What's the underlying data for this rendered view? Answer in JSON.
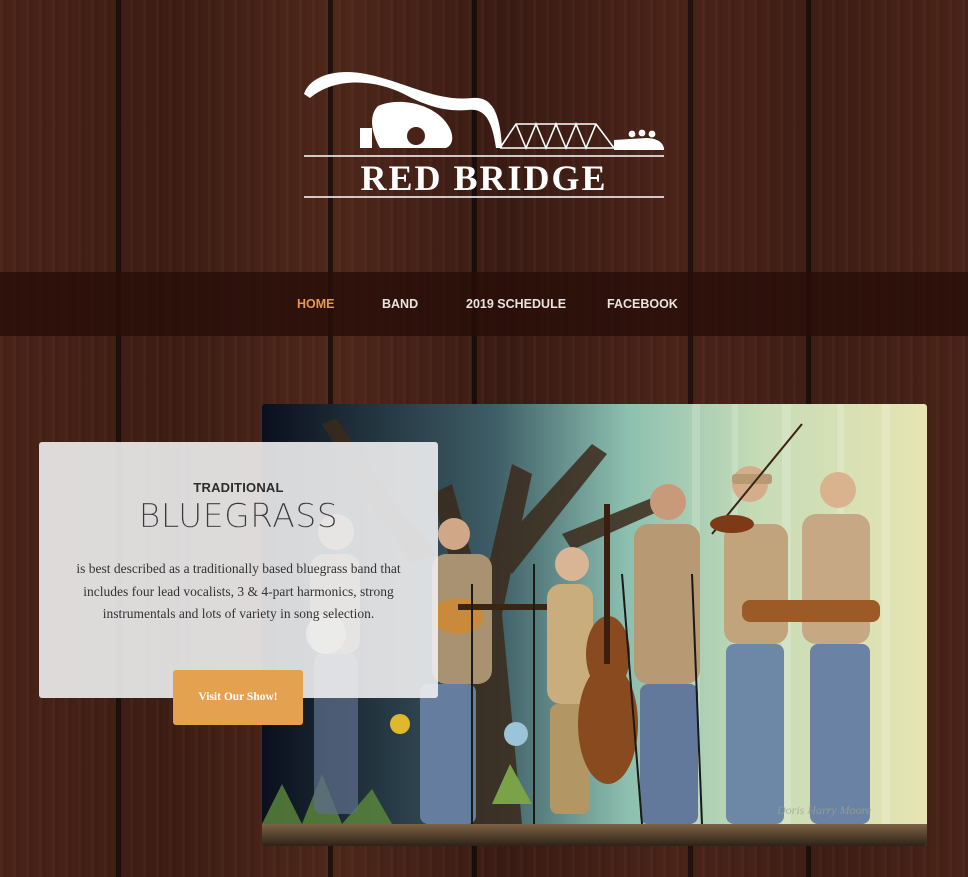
{
  "header": {
    "logo_text": "RED BRIDGE"
  },
  "nav": {
    "items": [
      {
        "label": "HOME",
        "active": true
      },
      {
        "label": "BAND",
        "active": false
      },
      {
        "label": "2019 SCHEDULE",
        "active": false
      },
      {
        "label": "FACEBOOK",
        "active": false
      }
    ],
    "active_color": "#e39a50"
  },
  "hero": {
    "kicker": "TRADITIONAL",
    "title": "BLUEGRASS",
    "body": "is best described as a traditionally based bluegrass band that includes four lead vocalists, 3 & 4-part harmonics, strong instrumentals and lots of variety in song selection.",
    "cta_label": "Visit Our Show!",
    "cta_color": "#e4a250",
    "photo_credit": "Doris Harry Moore"
  }
}
